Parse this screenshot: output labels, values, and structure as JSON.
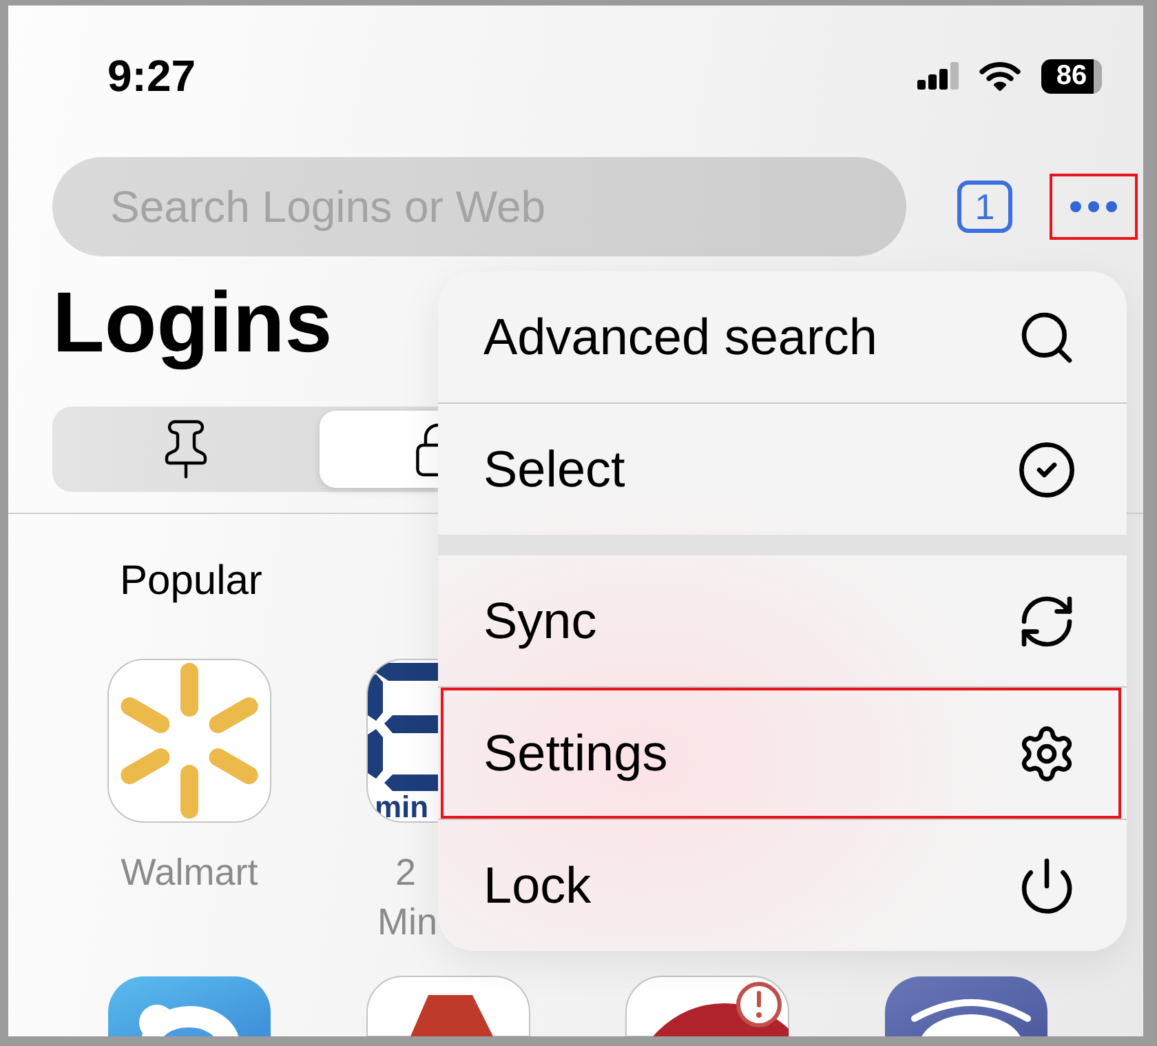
{
  "status_bar": {
    "time": "9:27",
    "battery": "86"
  },
  "search": {
    "placeholder": "Search Logins or Web"
  },
  "tab_count": "1",
  "more_button": {
    "highlighted": true
  },
  "title": "Logins",
  "segments": [
    {
      "kind": "pin",
      "selected": false
    },
    {
      "kind": "lock",
      "selected": true
    }
  ],
  "section_title": "Popular",
  "tiles": [
    {
      "kind": "sunburst",
      "label_lines": [
        "Walmart"
      ]
    },
    {
      "kind": "digit",
      "logo_text": "min",
      "label_lines": [
        "2",
        "Min"
      ]
    }
  ],
  "bottom_tiles": [
    {
      "kind": "cloud",
      "alert": false
    },
    {
      "kind": "letter",
      "alert": false
    },
    {
      "kind": "circle",
      "alert": true
    },
    {
      "kind": "arc",
      "alert": false
    }
  ],
  "menu": {
    "groups": [
      {
        "items": [
          {
            "kind": "search",
            "label": "Advanced search",
            "highlighted": false
          },
          {
            "kind": "select",
            "label": "Select",
            "highlighted": false
          }
        ]
      },
      {
        "items": [
          {
            "kind": "sync",
            "label": "Sync",
            "highlighted": false
          },
          {
            "kind": "settings",
            "label": "Settings",
            "highlighted": true
          },
          {
            "kind": "lock",
            "label": "Lock",
            "highlighted": false
          }
        ]
      }
    ]
  }
}
